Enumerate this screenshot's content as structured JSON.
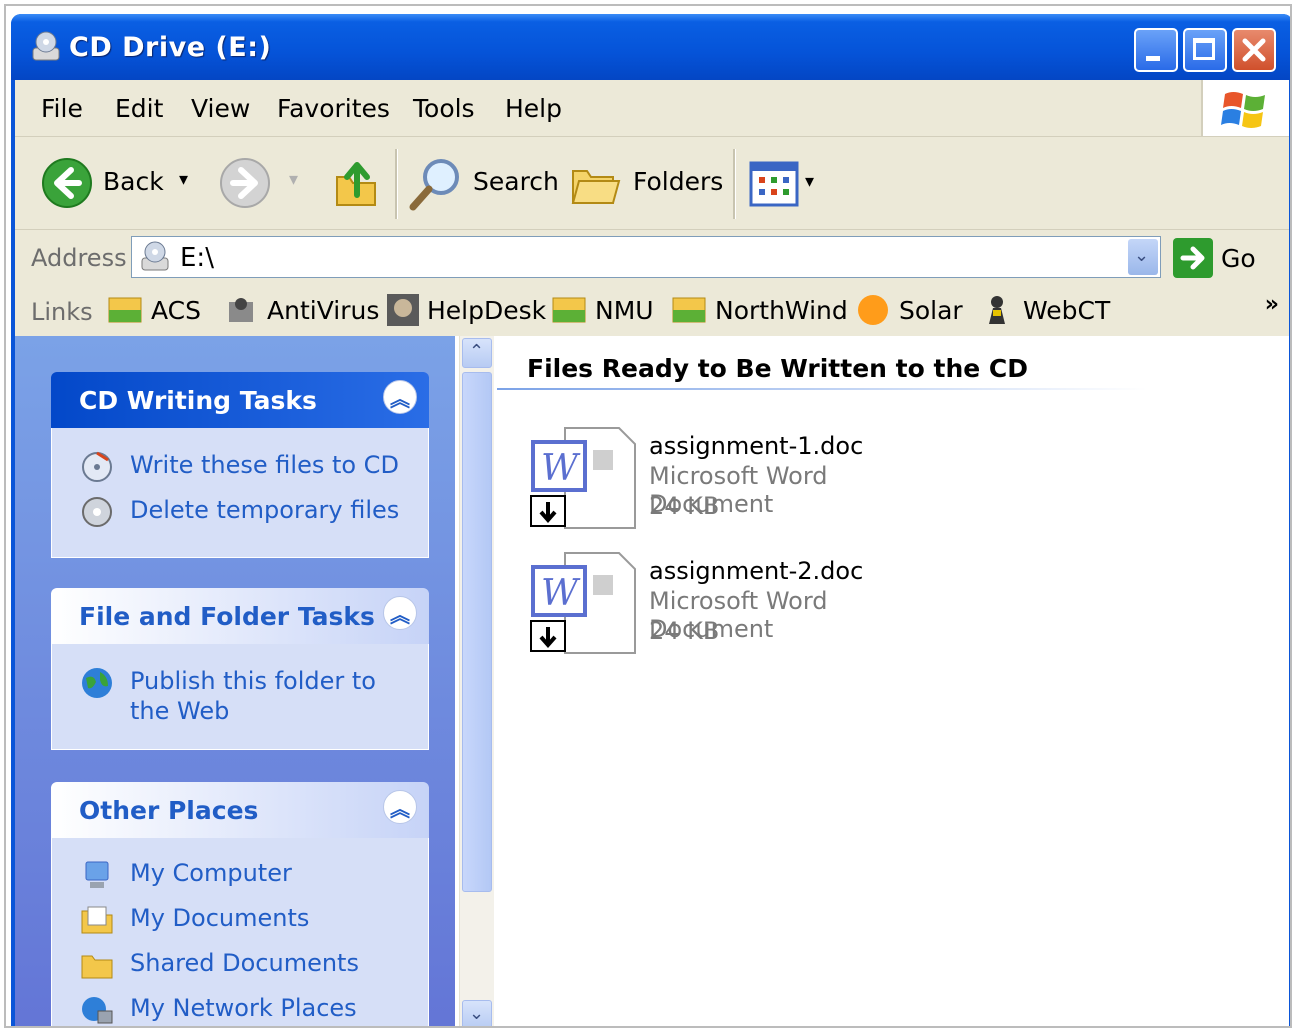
{
  "window": {
    "title": "CD Drive (E:)"
  },
  "menu": [
    "File",
    "Edit",
    "View",
    "Favorites",
    "Tools",
    "Help"
  ],
  "toolbar": {
    "back_label": "Back",
    "search_label": "Search",
    "folders_label": "Folders"
  },
  "address": {
    "label": "Address",
    "value": "E:\\",
    "go_label": "Go"
  },
  "links": {
    "label": "Links",
    "items": [
      "ACS",
      "AntiVirus",
      "HelpDesk",
      "NMU",
      "NorthWind",
      "Solar",
      "WebCT"
    ],
    "more": "»"
  },
  "tasks": {
    "cd_writing": {
      "title": "CD Writing Tasks",
      "items": [
        "Write these files to CD",
        "Delete temporary files"
      ]
    },
    "file_folder": {
      "title": "File and Folder Tasks",
      "items": [
        "Publish this folder to the Web"
      ]
    },
    "other_places": {
      "title": "Other Places",
      "items": [
        "My Computer",
        "My Documents",
        "Shared Documents",
        "My Network Places"
      ]
    }
  },
  "files": {
    "group_title": "Files Ready to Be Written to the CD",
    "items": [
      {
        "name": "assignment-1.doc",
        "type": "Microsoft Word Document",
        "size": "24 KB"
      },
      {
        "name": "assignment-2.doc",
        "type": "Microsoft Word Document",
        "size": "24 KB"
      }
    ]
  },
  "colors": {
    "titlebar": "#0553d8",
    "taskpane": "#6375d6",
    "link": "#215dc6",
    "chrome": "#ece9d8"
  }
}
